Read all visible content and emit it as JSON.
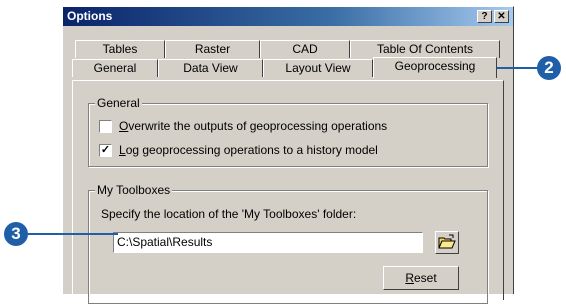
{
  "window": {
    "title": "Options",
    "help_label": "?",
    "close_label": "✕"
  },
  "tabs": {
    "row1": [
      "Tables",
      "Raster",
      "CAD",
      "Table Of Contents"
    ],
    "row2": [
      "General",
      "Data View",
      "Layout View",
      "Geoprocessing"
    ],
    "active": "Geoprocessing"
  },
  "general_group": {
    "legend": "General",
    "overwrite_label": "Overwrite the outputs of geoprocessing operations",
    "overwrite_checked": false,
    "log_label": "Log geoprocessing operations to a history model",
    "log_checked": true
  },
  "toolboxes_group": {
    "legend": "My Toolboxes",
    "instruction": "Specify the location of the 'My Toolboxes' folder:",
    "path_value": "C:\\Spatial\\Results",
    "browse_icon": "folder-open-icon",
    "reset_label": "Reset"
  },
  "callouts": [
    "2",
    "3"
  ],
  "colors": {
    "callout": "#1f5fa8",
    "titlebar": "#0a246a",
    "face": "#d4d0c8"
  }
}
